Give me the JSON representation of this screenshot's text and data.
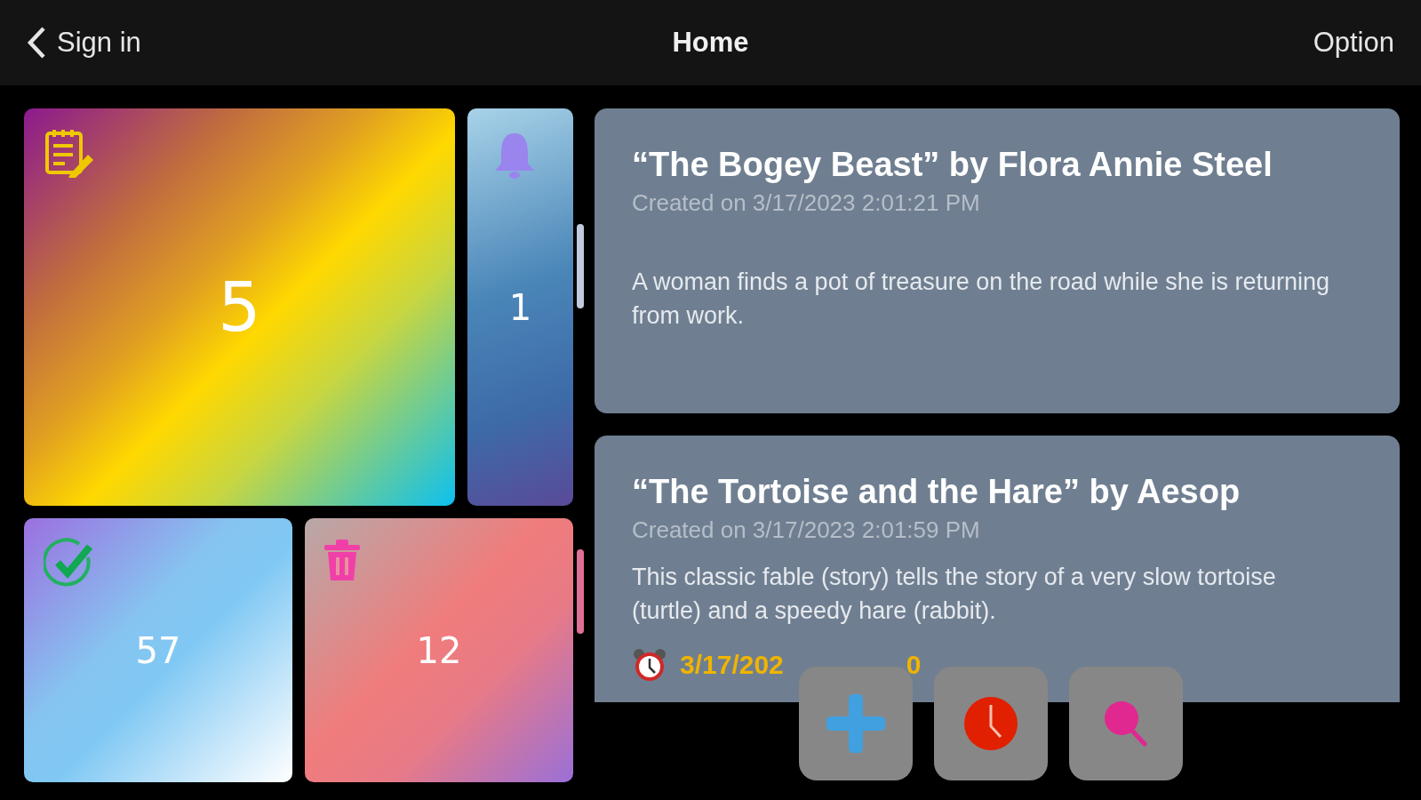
{
  "header": {
    "back_label": "Sign in",
    "title": "Home",
    "action": "Option"
  },
  "tiles": [
    {
      "kind": "notes",
      "count": "5"
    },
    {
      "kind": "reminders",
      "count": "1"
    },
    {
      "kind": "done",
      "count": "57"
    },
    {
      "kind": "trash",
      "count": "12"
    }
  ],
  "notes": [
    {
      "title": "“The Bogey Beast” by Flora Annie Steel",
      "created": "Created on 3/17/2023 2:01:21 PM",
      "body": "A woman finds a pot of treasure on the road while she is returning from work."
    },
    {
      "title": "“The Tortoise and the Hare” by Aesop",
      "created": "Created on 3/17/2023 2:01:59 PM",
      "body": "This classic fable (story) tells the story of a very slow tortoise (turtle) and a speedy hare (rabbit).",
      "reminder": [
        "3/17/202",
        "0"
      ]
    }
  ],
  "actions": [
    {
      "kind": "add"
    },
    {
      "kind": "history"
    },
    {
      "kind": "search"
    }
  ]
}
